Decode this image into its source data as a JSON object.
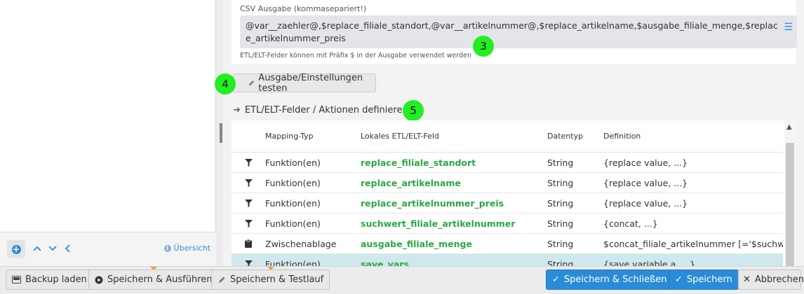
{
  "csv": {
    "label": "CSV Ausgabe (kommasepariert!)",
    "value": "@var__zaehler@,$replace_filiale_standort,@var__artikelnummer@,$replace_artikelname,$ausgabe_filiale_menge,$replace_artikelnummer_preis",
    "hint": "ETL/ELT-Felder können mit Präfix $ in der Ausgabe verwendet werden",
    "menu_icon": "hamburger-menu-icon"
  },
  "badges": [
    "3",
    "4",
    "5"
  ],
  "test_button": {
    "label": "Ausgabe/Einstellungen testen",
    "icon": "pencil-icon"
  },
  "section": {
    "title": "ETL/ELT-Felder / Aktionen definieren",
    "icon": "arrow-right-icon"
  },
  "table": {
    "headers": [
      "Mapping-Typ",
      "Lokales ETL/ELT-Feld",
      "Datentyp",
      "Definition"
    ],
    "rows": [
      {
        "icon": "filter-icon",
        "type": "Funktion(en)",
        "field": "replace_filiale_standort",
        "datatype": "String",
        "definition": "{replace value, ...}"
      },
      {
        "icon": "filter-icon",
        "type": "Funktion(en)",
        "field": "replace_artikelname",
        "datatype": "String",
        "definition": "{replace value, ...}"
      },
      {
        "icon": "filter-icon",
        "type": "Funktion(en)",
        "field": "replace_artikelnummer_preis",
        "datatype": "String",
        "definition": "{replace value, ...}"
      },
      {
        "icon": "filter-icon",
        "type": "Funktion(en)",
        "field": "suchwert_filiale_artikelnummer",
        "datatype": "String",
        "definition": "{concat, ...}"
      },
      {
        "icon": "clipboard-icon",
        "type": "Zwischenablage",
        "field": "ausgabe_filiale_menge",
        "datatype": "String",
        "definition": "$concat_filiale_artikelnummer [='$suchw..."
      },
      {
        "icon": "filter-icon",
        "type": "Funktion(en)",
        "field": "save_vars",
        "datatype": "String",
        "definition": "{save variable a, ...}"
      }
    ]
  },
  "sidebar": {
    "overview_label": "Übersicht"
  },
  "footer": {
    "backup": "Backup laden",
    "save_run": "Speichern & Ausführen",
    "save_test": "Speichern & Testlauf",
    "save_close": "Speichern & Schließen",
    "save": "Speichern",
    "cancel": "Abbrechen"
  },
  "colors": {
    "accent": "#2a8cd8",
    "field_green": "#2aa843",
    "badge_green": "#22ee22",
    "selected_row": "#cfe8ee"
  }
}
